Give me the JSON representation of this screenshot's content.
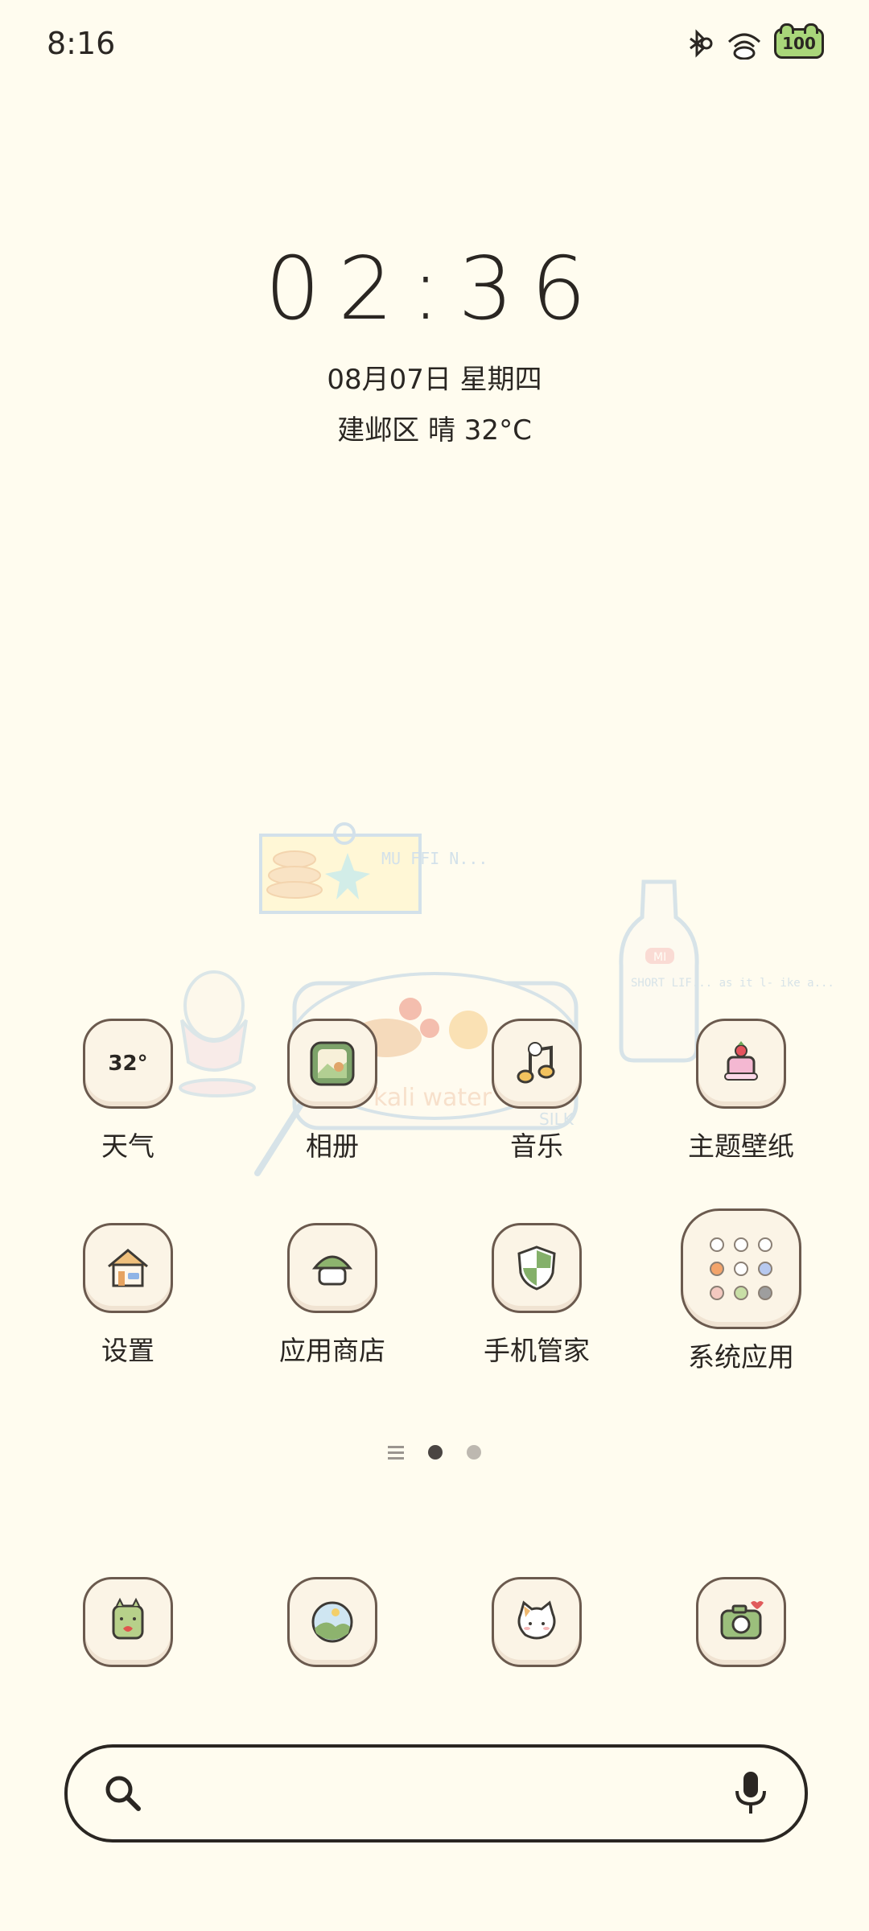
{
  "status_bar": {
    "time": "8:16",
    "battery": "100"
  },
  "clock": {
    "time": "02:36",
    "date": "08月07日 星期四",
    "weather": "建邺区 晴 32°C"
  },
  "apps": [
    {
      "label": "天气",
      "icon": "weather-icon",
      "badge": "32°"
    },
    {
      "label": "相册",
      "icon": "photos-icon"
    },
    {
      "label": "音乐",
      "icon": "music-icon"
    },
    {
      "label": "主题壁纸",
      "icon": "themes-icon"
    },
    {
      "label": "设置",
      "icon": "house-settings-icon"
    },
    {
      "label": "应用商店",
      "icon": "app-store-icon"
    },
    {
      "label": "手机管家",
      "icon": "shield-icon"
    },
    {
      "label": "系统应用",
      "icon": "folder-icon"
    }
  ],
  "pages": {
    "count": 2,
    "active": 1
  },
  "dock": [
    "phone-icon",
    "browser-icon",
    "messages-icon",
    "camera-icon"
  ],
  "search": {
    "placeholder": ""
  },
  "wallpaper_text": {
    "note": "MU FFI N...",
    "bottle_label": "MI",
    "bottle_text": "SHORT LIF... as it l- ike a...",
    "plate_text": "kali water",
    "silk": "SILK"
  }
}
